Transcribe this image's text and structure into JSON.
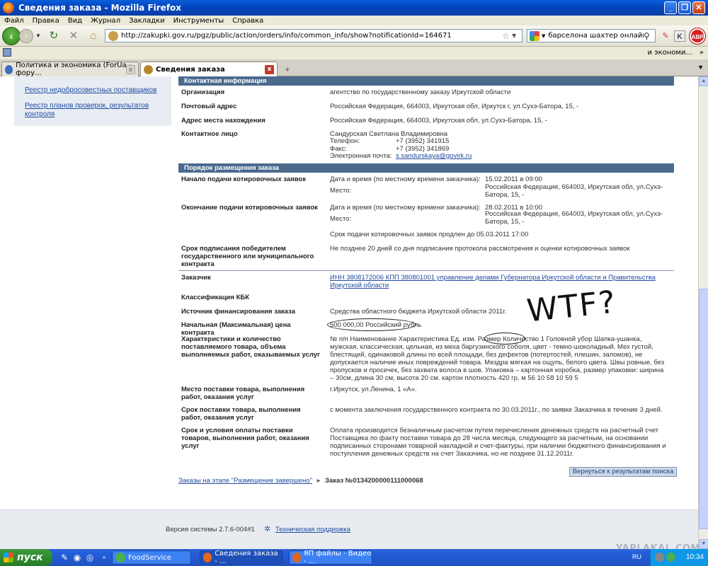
{
  "window": {
    "title": "Сведения заказа - Mozilla Firefox",
    "minimize": "_",
    "maximize": "❐",
    "close": "✕"
  },
  "menu": [
    "Файл",
    "Правка",
    "Вид",
    "Журнал",
    "Закладки",
    "Инструменты",
    "Справка"
  ],
  "nav": {
    "url": "http://zakupki.gov.ru/pgz/public/action/orders/info/common_info/show?notificationId=164671",
    "search_query": "барселона шахтер онлайн"
  },
  "bookmarks": {
    "right_text": "и экономи..."
  },
  "tabs": [
    {
      "label": "Политика и экономика (ForUa - фору...",
      "active": false
    },
    {
      "label": "Сведения заказа",
      "active": true
    }
  ],
  "sidebar": {
    "links": [
      "Реестр недобросовестных поставщиков",
      "Реестр планов проверок, результатов контроля"
    ]
  },
  "contact": {
    "header": "Контактная информация",
    "rows": [
      {
        "label": "Организация",
        "value": "агентство по государственному заказу Иркутской области"
      },
      {
        "label": "Почтовый адрес",
        "value": "Российская Федерация, 664003, Иркутская обл, Иркутск г, ул.Сухэ-Батора, 15, -"
      },
      {
        "label": "Адрес места нахождения",
        "value": "Российская Федерация, 664003, Иркутская обл, ул.Сухэ-Батора, 15, -"
      }
    ],
    "person_label": "Контактное лицо",
    "person_name": "Сандурская Светлана Владимировна",
    "phone_label": "Телефон:",
    "phone": "+7 (3952) 341915",
    "fax_label": "Факс:",
    "fax": "+7 (3952) 341869",
    "email_label": "Электронная почта:",
    "email": "s.sandurskaya@govirk.ru"
  },
  "order": {
    "header": "Порядок размещения заказа",
    "start_label": "Начало подачи котировочных заявок",
    "start_dt_label": "Дата и время (по местному времени заказчика):",
    "start_dt": "15.02.2011 в 09:00",
    "place_label": "Место:",
    "start_place": "Российская Федерация, 664003, Иркутская обл, ул.Сухэ-Батора, 15, -",
    "end_label": "Окончание подачи котировочных заявок",
    "end_dt_label": "Дата и время (по местному времени заказчика):",
    "end_dt": "28.02.2011 в 10:00",
    "end_place": "Российская Федерация, 664003, Иркутская обл, ул.Сухэ-Батора, 15, -",
    "extended": "Срок подачи котировочных заявок продлен до 05.03.2011 17:00",
    "sign_label": "Срок подписания победителем государственного или муниципального контракта",
    "sign_value": "Не позднее 20 дней со дня подписания протокола рассмотрения и оценки котировочных заявок"
  },
  "details": {
    "customer_label": "Заказчик",
    "customer_value": "ИНН 3808172006 КПП 380801001 управление делами Губернатора Иркутской области и Правительства Иркутской области",
    "kbk_label": "Классификация КБК",
    "source_label": "Источник финансирования заказа",
    "source_value": "Средства областного бюджета Иркутской области 2011г.",
    "price_label": "Начальная (Максимальная) цена контракта",
    "price_value": "500 000,00 Российский рубль",
    "chars_label": "Характеристики и количество поставляемого товара, объема выполняемых работ, оказываемых услуг",
    "chars_value": "№ п/п Наименование Характеристика Ед. изм. Размер Количество 1 Головной убор Шапка-ушанка, мужская, классическая, цельная, из меха баргузинского соболя, цвет - темно-шоколадный. Мех густой, блестящий, одинаковой длины по всей площади, без дефектов (потертостей, плешин, заломов), не допускается наличие иных повреждений товара. Мездра мягкая на ощупь, белого цвета. Швы ровные, без пропусков и просечек, без захвата волоса в шов. Упаковка – картонная коробка, размер упаковки: ширина – 30см, длина 30 см, высота 20 см. картон плотность 420 гр. м 56 10 58 10 59 5",
    "place_label": "Место поставки товара, выполнения работ, оказания услуг",
    "place_value": "г.Иркутск, ул.Ленина, 1 «А».",
    "term_label": "Срок поставки товара, выполнения работ, оказания услуг",
    "term_value": "с момента заключения государственного контракта по 30.03.2011г., по заявке Заказчика в течение 3 дней.",
    "pay_label": "Срок и условия оплаты поставки товаров, выполнения работ, оказания услуг",
    "pay_value": "Оплата производится безналичным расчетом путем перечисления денежных средств на расчетный счет Поставщика по факту поставки товара до 28 числа месяца, следующего за расчетным, на основании подписанных сторонами товарной накладной и счет-фактуры, при наличии бюджетного финансирования и поступления денежных средств на счет Заказчика, но не позднее 31.12.2011г."
  },
  "annotation": "WTF?",
  "actions": {
    "back_results": "Вернуться к результатам поиска"
  },
  "breadcrumb": {
    "link": "Заказы на этапе \"Размещение завершено\"",
    "current": "Заказ №0134200000111000068"
  },
  "footer": {
    "version": "Версия системы 2.7.6-004#1",
    "support": "Техническая поддержка"
  },
  "taskbar": {
    "start": "пуск",
    "tasks": [
      "FoodService",
      "Сведения заказа - ...",
      "ЯП файлы - Видео - ..."
    ],
    "lang": "RU",
    "clock": "10:34"
  },
  "watermark": "YAPLAKAL.COM"
}
